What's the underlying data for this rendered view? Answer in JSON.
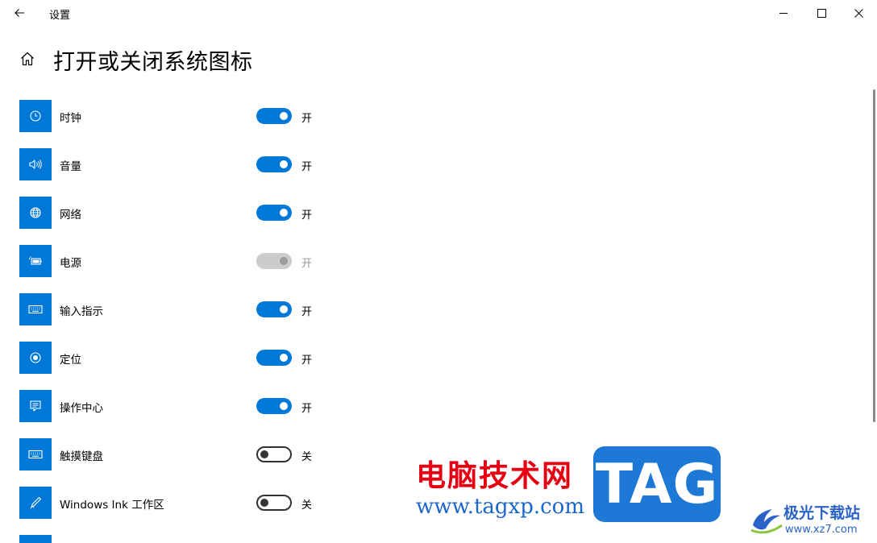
{
  "window": {
    "title": "设置"
  },
  "page": {
    "title": "打开或关闭系统图标"
  },
  "items": [
    {
      "label": "时钟",
      "state": "开",
      "on": true,
      "disabled": false,
      "icon": "clock-icon"
    },
    {
      "label": "音量",
      "state": "开",
      "on": true,
      "disabled": false,
      "icon": "volume-icon"
    },
    {
      "label": "网络",
      "state": "开",
      "on": true,
      "disabled": false,
      "icon": "network-icon"
    },
    {
      "label": "电源",
      "state": "开",
      "on": true,
      "disabled": true,
      "icon": "battery-icon"
    },
    {
      "label": "输入指示",
      "state": "开",
      "on": true,
      "disabled": false,
      "icon": "keyboard-icon"
    },
    {
      "label": "定位",
      "state": "开",
      "on": true,
      "disabled": false,
      "icon": "location-icon"
    },
    {
      "label": "操作中心",
      "state": "开",
      "on": true,
      "disabled": false,
      "icon": "action-center-icon"
    },
    {
      "label": "触摸键盘",
      "state": "关",
      "on": false,
      "disabled": false,
      "icon": "touch-keyboard-icon"
    },
    {
      "label": "Windows Ink 工作区",
      "state": "关",
      "on": false,
      "disabled": false,
      "icon": "pen-icon"
    }
  ],
  "watermark": {
    "site_name": "电脑技术网",
    "site_url": "www.tagxp.com",
    "tag_text": "TAG",
    "xz_name": "极光下载站",
    "xz_url": "www.xz7.com"
  },
  "colors": {
    "accent": "#0078d7",
    "toggle_disabled": "#cccccc",
    "watermark_red": "#e60012",
    "watermark_blue": "#1e78d6"
  }
}
